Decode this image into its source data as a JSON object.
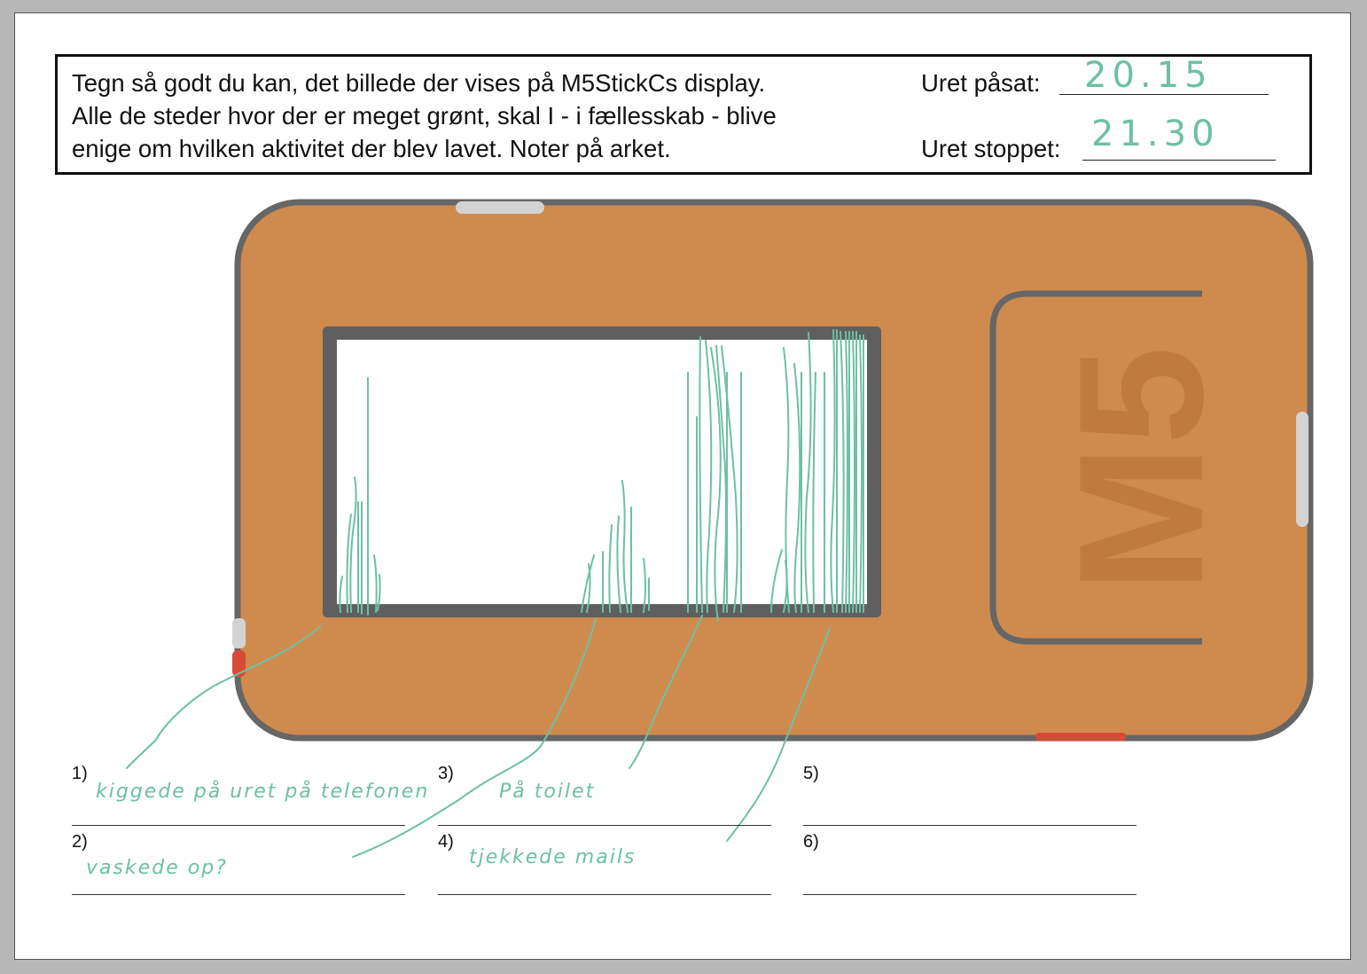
{
  "instructions": {
    "line1": "Tegn så godt du kan, det billede der vises på M5StickCs display.",
    "line2": "Alle de steder hvor der er meget grønt, skal I - i fællesskab - blive",
    "line3": "enige om hvilken aktivitet der blev lavet. Noter på arket."
  },
  "times": {
    "on_label": "Uret påsat:",
    "on_value": "20.15",
    "off_label": "Uret stoppet:",
    "off_value": "21.30"
  },
  "device": {
    "logo": "M5",
    "body_color": "#cf8a4e",
    "frame_color": "#666666",
    "logo_color": "#c17a3e",
    "button_color": "#d94a35",
    "ink_color": "#6dbfa5"
  },
  "answers": [
    {
      "number": "1)",
      "text": "kiggede på uret på telefonen"
    },
    {
      "number": "2)",
      "text": "vaskede op?"
    },
    {
      "number": "3)",
      "text": "På toilet"
    },
    {
      "number": "4)",
      "text": "tjekkede mails"
    },
    {
      "number": "5)",
      "text": ""
    },
    {
      "number": "6)",
      "text": ""
    }
  ]
}
